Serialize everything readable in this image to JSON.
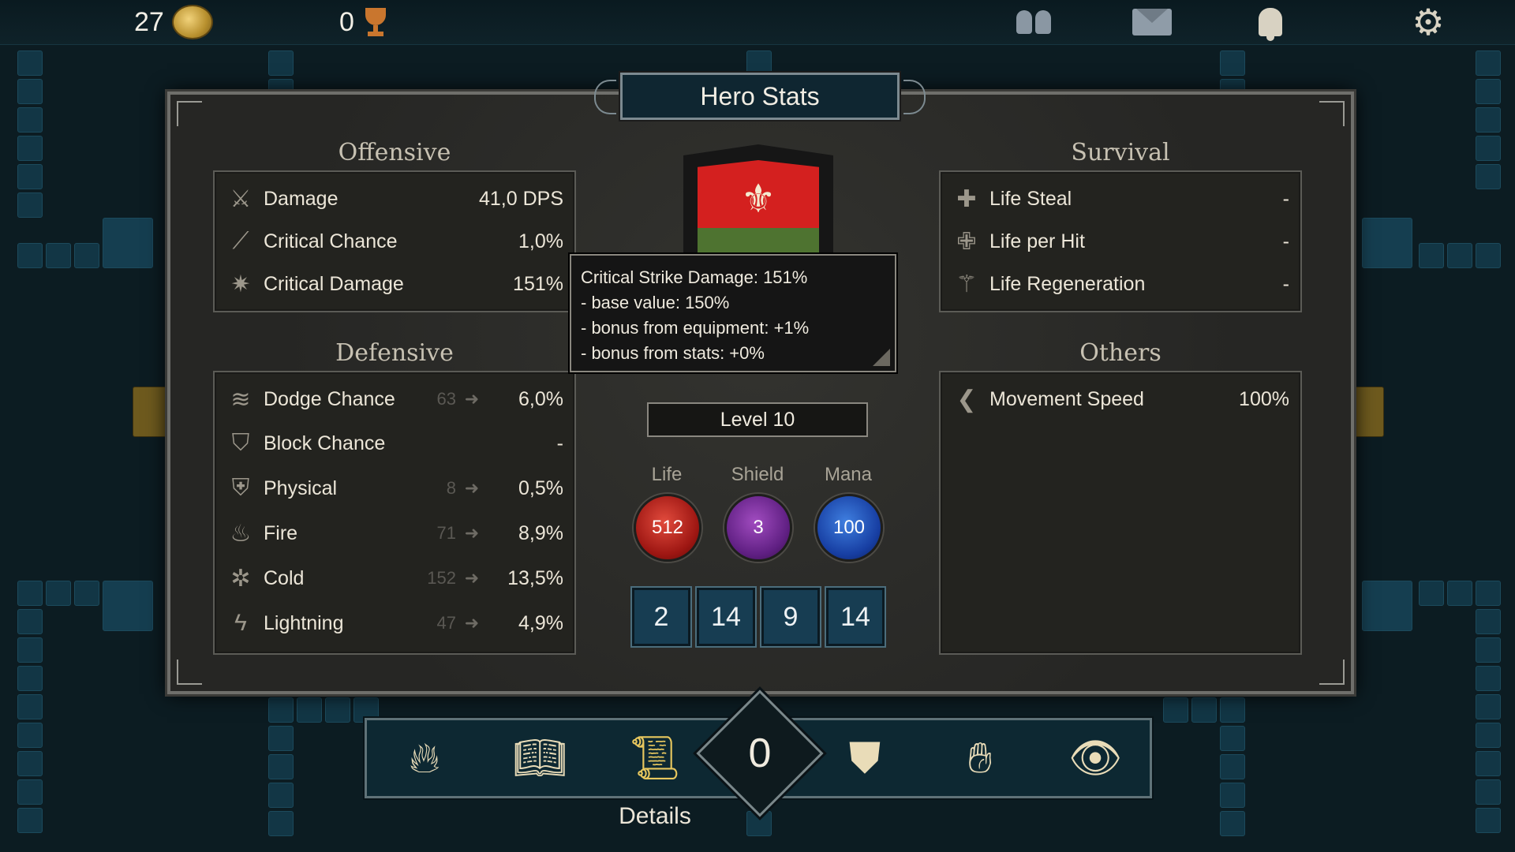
{
  "topbar": {
    "gold": "27",
    "trophies": "0",
    "icons": [
      "friends-icon",
      "mail-icon",
      "bell-icon",
      "gear-icon"
    ]
  },
  "window": {
    "title": "Hero Stats"
  },
  "offensive": {
    "title": "Offensive",
    "rows": [
      {
        "icon": "crossed-swords-icon",
        "label": "Damage",
        "value": "41,0 DPS"
      },
      {
        "icon": "slash-icon",
        "label": "Critical Chance",
        "value": "1,0%"
      },
      {
        "icon": "burst-icon",
        "label": "Critical Damage",
        "value": "151%"
      }
    ]
  },
  "defensive": {
    "title": "Defensive",
    "rows": [
      {
        "icon": "dodge-icon",
        "label": "Dodge Chance",
        "base": "63",
        "value": "6,0%"
      },
      {
        "icon": "shield-icon",
        "label": "Block Chance",
        "base": "",
        "value": "-"
      },
      {
        "icon": "helmet-icon",
        "label": "Physical",
        "base": "8",
        "value": "0,5%"
      },
      {
        "icon": "fire-shield-icon",
        "label": "Fire",
        "base": "71",
        "value": "8,9%"
      },
      {
        "icon": "cold-shield-icon",
        "label": "Cold",
        "base": "152",
        "value": "13,5%"
      },
      {
        "icon": "lightning-shield-icon",
        "label": "Lightning",
        "base": "47",
        "value": "4,9%"
      }
    ]
  },
  "survival": {
    "title": "Survival",
    "rows": [
      {
        "icon": "life-steal-icon",
        "label": "Life Steal",
        "value": "-"
      },
      {
        "icon": "life-hit-icon",
        "label": "Life per Hit",
        "value": "-"
      },
      {
        "icon": "regen-icon",
        "label": "Life Regeneration",
        "value": "-"
      }
    ]
  },
  "others": {
    "title": "Others",
    "rows": [
      {
        "icon": "movement-icon",
        "label": "Movement Speed",
        "value": "100%"
      }
    ]
  },
  "tooltip": {
    "lines": [
      "Critical Strike Damage: 151%",
      "- base value: 150%",
      "- bonus from equipment: +1%",
      "- bonus from stats: +0%"
    ]
  },
  "hero": {
    "level": "Level 10",
    "orbs": [
      {
        "label": "Life",
        "value": "512"
      },
      {
        "label": "Shield",
        "value": "3"
      },
      {
        "label": "Mana",
        "value": "100"
      }
    ],
    "attributes": [
      "2",
      "14",
      "9",
      "14"
    ]
  },
  "bottombar": {
    "buttons": [
      "campfire-icon",
      "book-icon",
      "scroll-icon",
      "armor-icon",
      "hand-icon",
      "eye-icon"
    ],
    "center_value": "0",
    "active_label": "Details"
  },
  "colors": {
    "background": "#0c1c22",
    "panel": "#2a2a28",
    "life": "#c0201a",
    "shield": "#7a2ea0",
    "mana": "#1f4fc0"
  }
}
